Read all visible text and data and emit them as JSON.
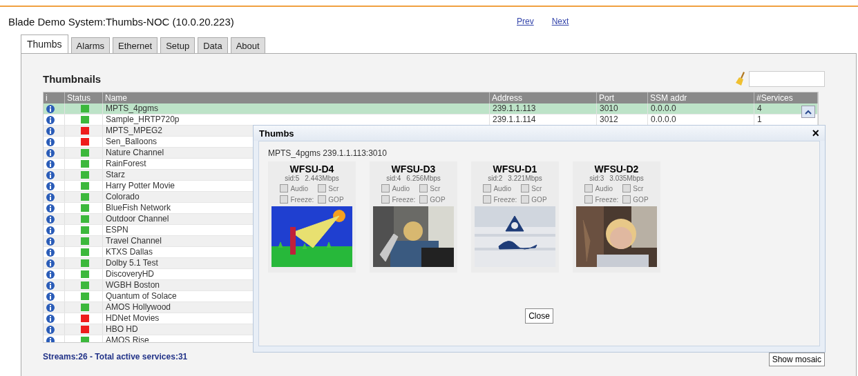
{
  "header": {
    "title": "Blade Demo System:Thumbs-NOC (10.0.20.223)",
    "links": [
      "Prev",
      "Next"
    ]
  },
  "tabs": [
    {
      "label": "Thumbs",
      "selected": true
    },
    {
      "label": "Alarms",
      "selected": false
    },
    {
      "label": "Ethernet",
      "selected": false
    },
    {
      "label": "Setup",
      "selected": false
    },
    {
      "label": "Data",
      "selected": false
    },
    {
      "label": "About",
      "selected": false
    }
  ],
  "panel": {
    "title": "Thumbnails",
    "footer": "Streams:26 - Total active services:31",
    "button": "Show mosaic"
  },
  "table": {
    "columns": [
      "i",
      "Status",
      "Name",
      "Address",
      "Port",
      "SSM addr",
      "#Services"
    ],
    "rows": [
      {
        "name": "MPTS_4pgms",
        "color": "#3cb83c",
        "selected": true,
        "address": "239.1.1.113",
        "port": "3010",
        "ssm": "0.0.0.0",
        "services": "4"
      },
      {
        "name": "Sample_HRTP720p",
        "color": "#3cb83c",
        "selected": false,
        "address": "239.1.1.114",
        "port": "3012",
        "ssm": "0.0.0.0",
        "services": "1"
      },
      {
        "name": "MPTS_MPEG2",
        "color": "#ee1c1c",
        "selected": false
      },
      {
        "name": "Sen_Balloons",
        "color": "#ee1c1c",
        "selected": false
      },
      {
        "name": "Nature Channel",
        "color": "#3cb83c",
        "selected": false
      },
      {
        "name": "RainForest",
        "color": "#3cb83c",
        "selected": false
      },
      {
        "name": "Starz",
        "color": "#3cb83c",
        "selected": false
      },
      {
        "name": "Harry Potter Movie",
        "color": "#3cb83c",
        "selected": false
      },
      {
        "name": "Colorado",
        "color": "#3cb83c",
        "selected": false
      },
      {
        "name": "BlueFish Network",
        "color": "#3cb83c",
        "selected": false
      },
      {
        "name": "Outdoor Channel",
        "color": "#3cb83c",
        "selected": false
      },
      {
        "name": "ESPN",
        "color": "#3cb83c",
        "selected": false
      },
      {
        "name": "Travel Channel",
        "color": "#3cb83c",
        "selected": false
      },
      {
        "name": "KTXS Dallas",
        "color": "#3cb83c",
        "selected": false
      },
      {
        "name": "Dolby 5.1 Test",
        "color": "#3cb83c",
        "selected": false
      },
      {
        "name": "DiscoveryHD",
        "color": "#3cb83c",
        "selected": false
      },
      {
        "name": "WGBH Boston",
        "color": "#3cb83c",
        "selected": false
      },
      {
        "name": "Quantum of Solace",
        "color": "#3cb83c",
        "selected": false
      },
      {
        "name": "AMOS Hollywood",
        "color": "#3cb83c",
        "selected": false
      },
      {
        "name": "HDNet Movies",
        "color": "#ee1c1c",
        "selected": false
      },
      {
        "name": "HBO HD",
        "color": "#ee1c1c",
        "selected": false
      },
      {
        "name": "AMOS Rise",
        "color": "#3cb83c",
        "selected": false
      }
    ]
  },
  "dialog": {
    "title": "Thumbs",
    "close_icon": "×",
    "subtitle": "MPTS_4pgms 239.1.1.113:3010",
    "button": "Close",
    "thumbs": [
      {
        "name": "WFSU-D4",
        "sid": "sid:5",
        "rate": "2.443Mbps",
        "options": [
          {
            "label": "Audio",
            "checked": false
          },
          {
            "label": "Scr",
            "checked": false
          },
          {
            "label": "Freeze:",
            "checked": false
          },
          {
            "label": "GOP",
            "checked": false
          }
        ]
      },
      {
        "name": "WFSU-D3",
        "sid": "sid:4",
        "rate": "6.256Mbps",
        "options": [
          {
            "label": "Audio",
            "checked": false
          },
          {
            "label": "Scr",
            "checked": false
          },
          {
            "label": "Freeze:",
            "checked": false
          },
          {
            "label": "GOP",
            "checked": false
          }
        ]
      },
      {
        "name": "WFSU-D1",
        "sid": "sid:2",
        "rate": "3.221Mbps",
        "options": [
          {
            "label": "Audio",
            "checked": false
          },
          {
            "label": "Scr",
            "checked": false
          },
          {
            "label": "Freeze:",
            "checked": false
          },
          {
            "label": "GOP",
            "checked": false
          }
        ]
      },
      {
        "name": "WFSU-D2",
        "sid": "sid:3",
        "rate": "3.035Mbps",
        "options": [
          {
            "label": "Audio",
            "checked": false
          },
          {
            "label": "Scr",
            "checked": false
          },
          {
            "label": "Freeze:",
            "checked": false
          },
          {
            "label": "GOP",
            "checked": false
          }
        ]
      }
    ]
  }
}
